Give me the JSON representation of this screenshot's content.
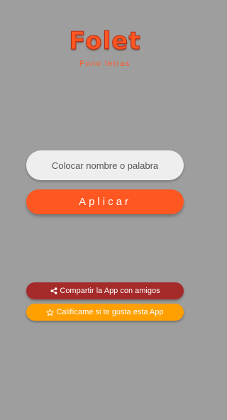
{
  "header": {
    "title": "Folet",
    "subtitle": "Fono letras"
  },
  "form": {
    "input_placeholder": "Colocar nombre o palabra",
    "input_value": "",
    "apply_label": "Aplicar"
  },
  "actions": {
    "share_label": "Compartir la App con amigos",
    "share_icon": "share-icon",
    "rate_label": "Califícame si te gusta esta App",
    "rate_icon": "star-outline-icon"
  },
  "colors": {
    "background": "#9e9e9e",
    "accent": "#ff5722",
    "share": "#a52a2a",
    "rate": "#ffa000",
    "input_bg": "#eeeeee"
  }
}
